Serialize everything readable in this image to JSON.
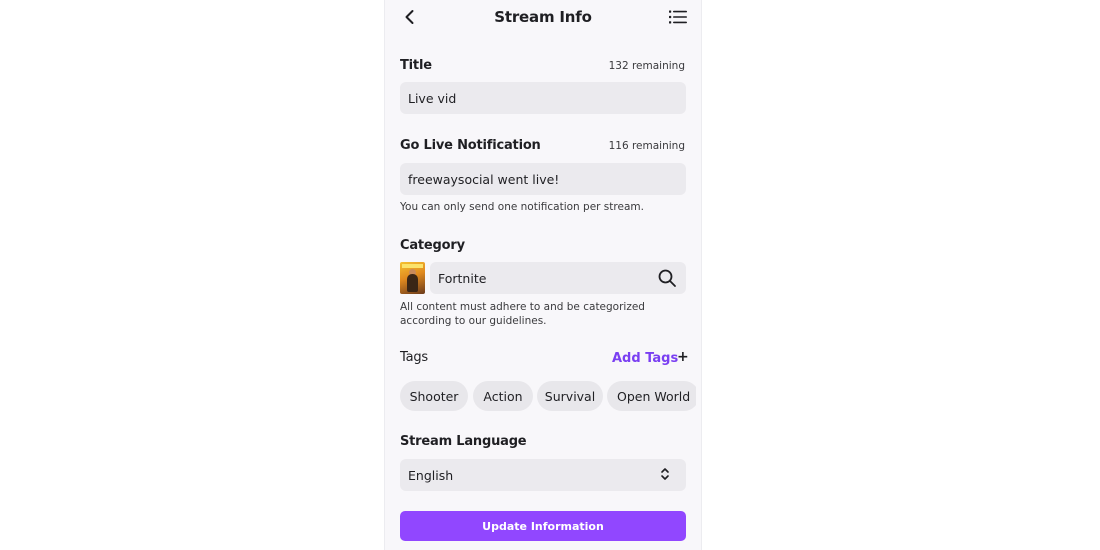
{
  "header": {
    "title": "Stream Info",
    "back_icon": "chevron-left-icon",
    "menu_icon": "list-icon"
  },
  "title_field": {
    "label": "Title",
    "remaining": "132 remaining",
    "value": "Live vid"
  },
  "notification_field": {
    "label": "Go Live Notification",
    "remaining": "116 remaining",
    "value": "freewaysocial went live!",
    "help": "You can only send one notification per stream."
  },
  "category": {
    "label": "Category",
    "value": "Fortnite",
    "search_icon": "search-icon",
    "help_line1": "All content must adhere to and be categorized",
    "help_line2": "according to our guidelines."
  },
  "tags": {
    "label": "Tags",
    "add_label": "Add Tags",
    "add_icon": "+",
    "items": [
      "Shooter",
      "Action",
      "Survival",
      "Open World"
    ]
  },
  "language": {
    "label": "Stream Language",
    "value": "English",
    "icon": "up-down-chevron-icon"
  },
  "update_button": {
    "label": "Update Information"
  },
  "colors": {
    "accent": "#9147ff",
    "add_tags_text": "#7a3ff2",
    "field_bg": "#ebeaee",
    "panel_bg": "#f8f7fa"
  }
}
